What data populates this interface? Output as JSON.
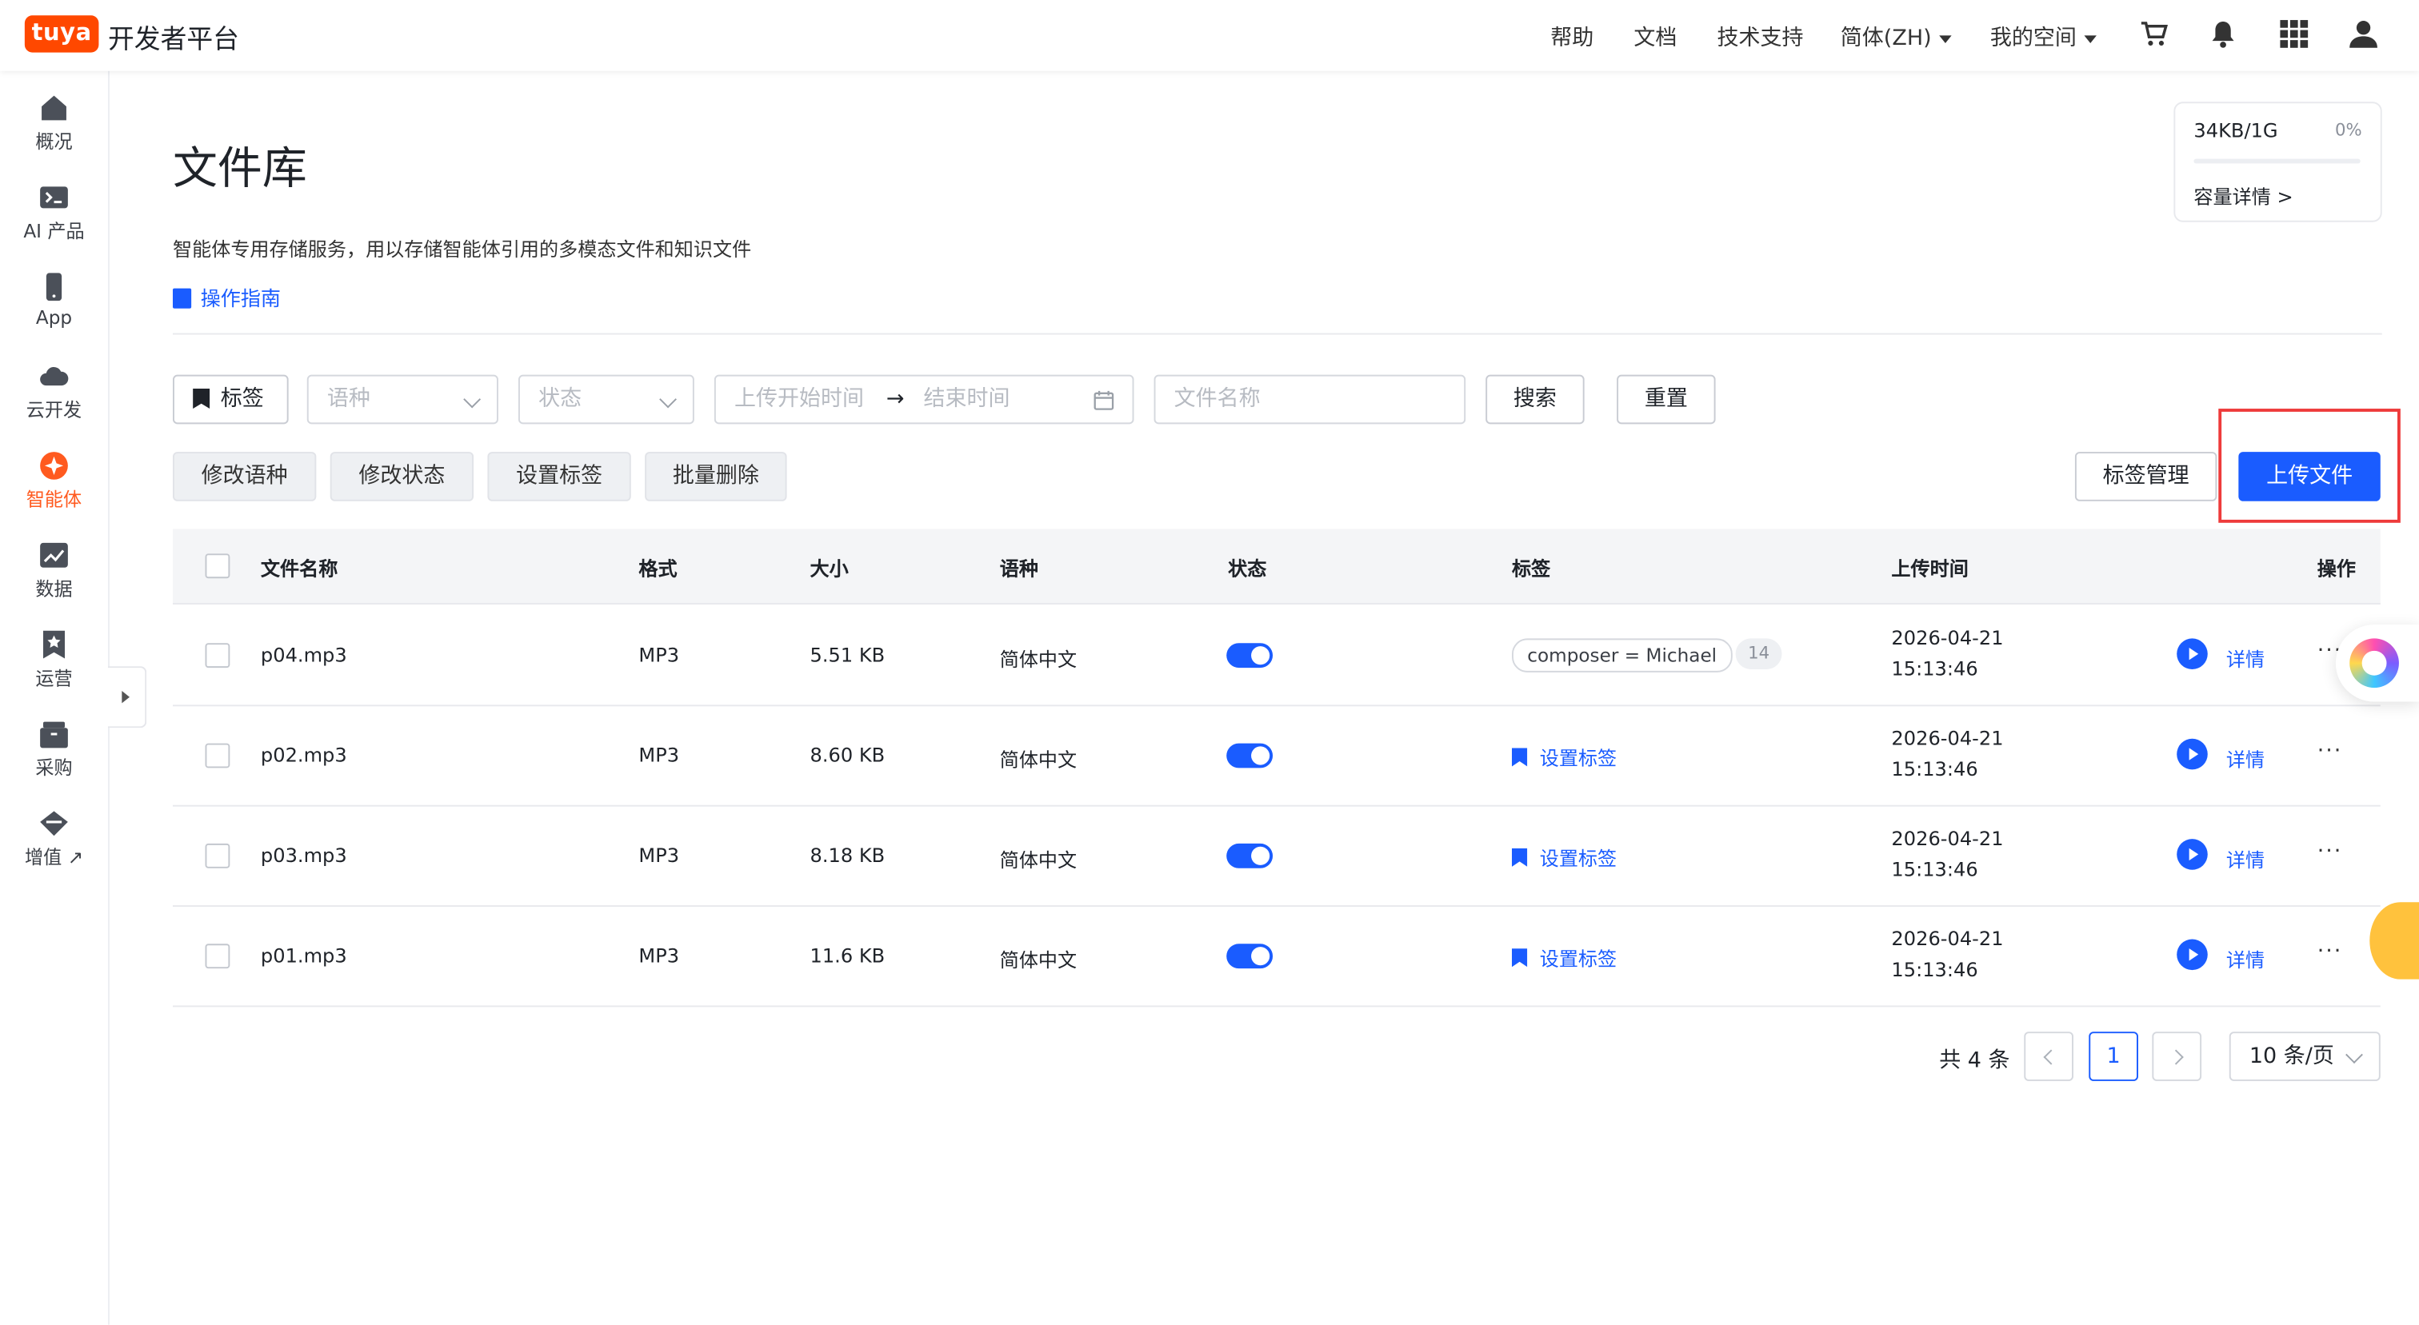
{
  "brand": {
    "logo": "tuya",
    "title": "开发者平台",
    "color": "#ff4800"
  },
  "topnav": {
    "help": "帮助",
    "docs": "文档",
    "support": "技术支持",
    "lang": "简体(ZH)",
    "space": "我的空间"
  },
  "topicons": [
    "cart-icon",
    "bell-icon",
    "grid-icon",
    "user-icon"
  ],
  "sidebar": {
    "items": [
      {
        "label": "概况",
        "icon": "home-icon"
      },
      {
        "label": "AI 产品",
        "icon": "terminal-icon"
      },
      {
        "label": "App",
        "icon": "phone-icon"
      },
      {
        "label": "云开发",
        "icon": "cloud-icon"
      },
      {
        "label": "智能体",
        "icon": "agent-icon",
        "active": true
      },
      {
        "label": "数据",
        "icon": "chart-icon"
      },
      {
        "label": "运营",
        "icon": "star-icon"
      },
      {
        "label": "采购",
        "icon": "box-icon"
      },
      {
        "label": "增值 ↗",
        "icon": "diamond-icon"
      }
    ]
  },
  "page": {
    "title": "文件库",
    "description": "智能体专用存储服务，用以存储智能体引用的多模态文件和知识文件",
    "guide": "操作指南"
  },
  "storage": {
    "used": "34KB/1G",
    "percent": "0%",
    "percent_value": 0,
    "link": "容量详情 >"
  },
  "filters": {
    "tag_button": "标签",
    "language_placeholder": "语种",
    "status_placeholder": "状态",
    "start_placeholder": "上传开始时间",
    "end_placeholder": "结束时间",
    "filename_placeholder": "文件名称",
    "search": "搜索",
    "reset": "重置"
  },
  "actions": {
    "edit_language": "修改语种",
    "edit_status": "修改状态",
    "set_tag": "设置标签",
    "batch_delete": "批量删除",
    "tag_manage": "标签管理",
    "upload": "上传文件"
  },
  "table": {
    "headers": {
      "name": "文件名称",
      "format": "格式",
      "size": "大小",
      "language": "语种",
      "status": "状态",
      "tags": "标签",
      "upload_time": "上传时间",
      "actions": "操作"
    },
    "rows": [
      {
        "name": "p04.mp3",
        "format": "MP3",
        "size": "5.51 KB",
        "language": "简体中文",
        "enabled": true,
        "tag": "composer = Michael",
        "tag_count": "14",
        "date": "2026-04-21",
        "time": "15:13:46",
        "detail": "详情",
        "more": "···"
      },
      {
        "name": "p02.mp3",
        "format": "MP3",
        "size": "8.60 KB",
        "language": "简体中文",
        "enabled": true,
        "set_tag": "设置标签",
        "date": "2026-04-21",
        "time": "15:13:46",
        "detail": "详情",
        "more": "···"
      },
      {
        "name": "p03.mp3",
        "format": "MP3",
        "size": "8.18 KB",
        "language": "简体中文",
        "enabled": true,
        "set_tag": "设置标签",
        "date": "2026-04-21",
        "time": "15:13:46",
        "detail": "详情",
        "more": "···"
      },
      {
        "name": "p01.mp3",
        "format": "MP3",
        "size": "11.6 KB",
        "language": "简体中文",
        "enabled": true,
        "set_tag": "设置标签",
        "date": "2026-04-21",
        "time": "15:13:46",
        "detail": "详情",
        "more": "···"
      }
    ]
  },
  "pagination": {
    "total": "共 4 条",
    "current": "1",
    "page_size": "10 条/页"
  },
  "colors": {
    "primary": "#1a5cff",
    "active_nav": "#ff5a1f",
    "highlight": "#ee3b3b"
  }
}
